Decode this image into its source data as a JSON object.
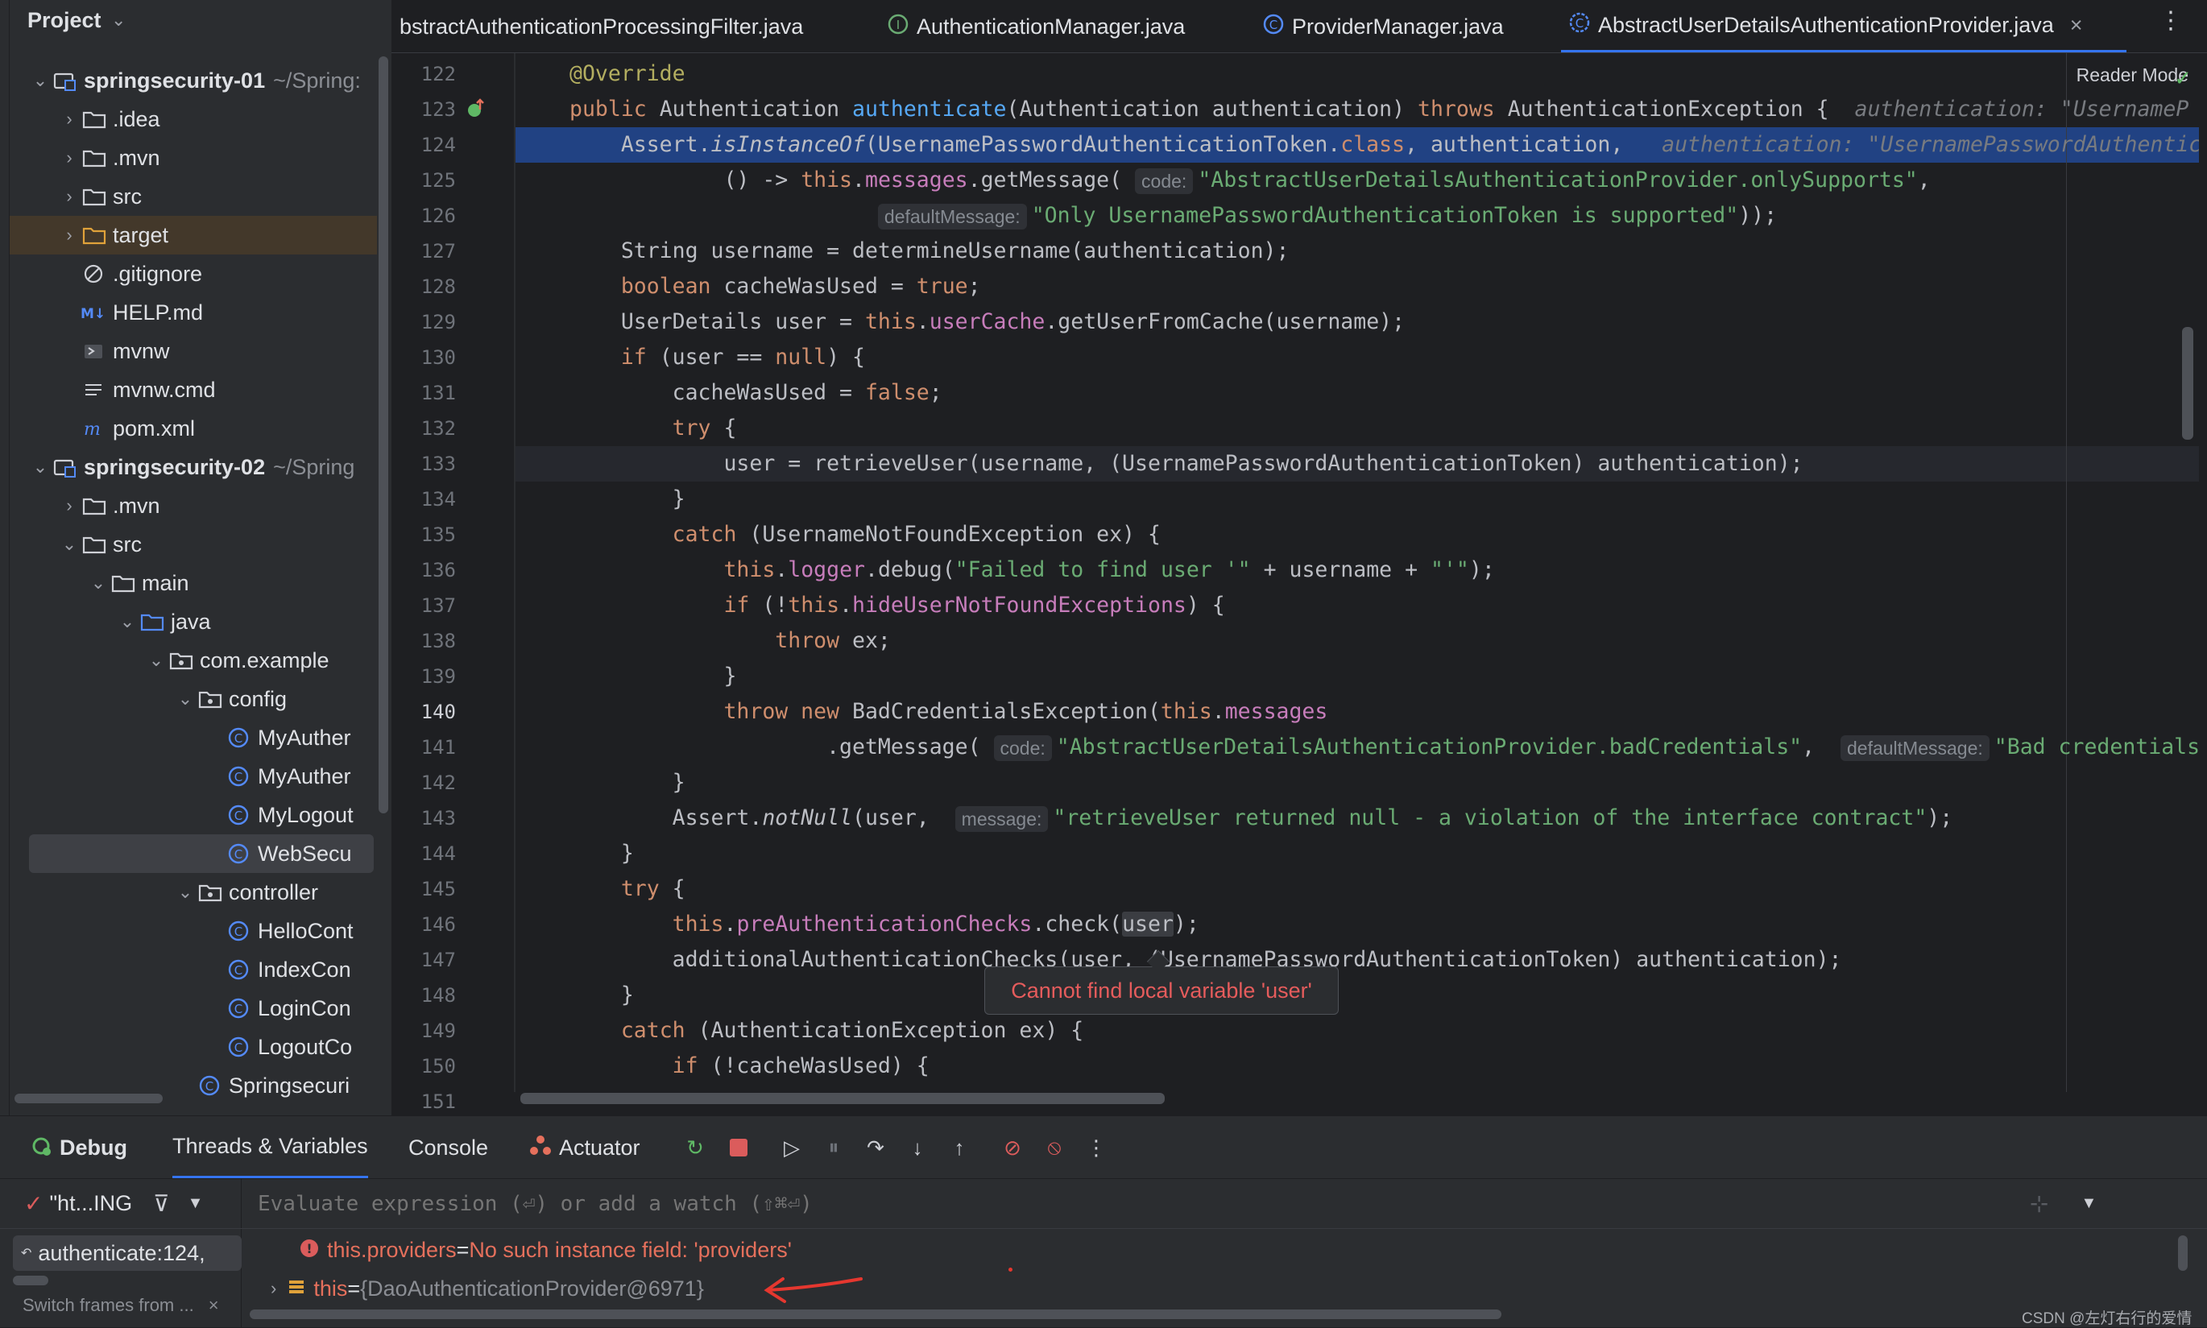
{
  "project": {
    "title": "Project",
    "tree": [
      {
        "label": "springsecurity-01",
        "note": "~/Spring:",
        "type": "module",
        "expanded": true,
        "indent": 0
      },
      {
        "label": ".idea",
        "type": "folder",
        "expanded": false,
        "indent": 1
      },
      {
        "label": ".mvn",
        "type": "folder",
        "expanded": false,
        "indent": 1
      },
      {
        "label": "src",
        "type": "folder",
        "expanded": false,
        "indent": 1
      },
      {
        "label": "target",
        "type": "folder-excluded",
        "expanded": false,
        "indent": 1
      },
      {
        "label": ".gitignore",
        "type": "ignore",
        "indent": 1
      },
      {
        "label": "HELP.md",
        "type": "md",
        "indent": 1
      },
      {
        "label": "mvnw",
        "type": "shell",
        "indent": 1
      },
      {
        "label": "mvnw.cmd",
        "type": "text",
        "indent": 1
      },
      {
        "label": "pom.xml",
        "type": "maven",
        "indent": 1
      },
      {
        "label": "springsecurity-02",
        "note": "~/Spring",
        "type": "module",
        "expanded": true,
        "indent": 0
      },
      {
        "label": ".mvn",
        "type": "folder",
        "expanded": false,
        "indent": 1
      },
      {
        "label": "src",
        "type": "folder",
        "expanded": true,
        "indent": 1
      },
      {
        "label": "main",
        "type": "folder",
        "expanded": true,
        "indent": 2
      },
      {
        "label": "java",
        "type": "folder-src",
        "expanded": true,
        "indent": 3
      },
      {
        "label": "com.example",
        "type": "package",
        "expanded": true,
        "indent": 4
      },
      {
        "label": "config",
        "type": "package",
        "expanded": true,
        "indent": 5
      },
      {
        "label": "MyAuther",
        "type": "class",
        "indent": 6
      },
      {
        "label": "MyAuther",
        "type": "class",
        "indent": 6
      },
      {
        "label": "MyLogout",
        "type": "class",
        "indent": 6
      },
      {
        "label": "WebSecu",
        "type": "class",
        "indent": 6
      },
      {
        "label": "controller",
        "type": "package",
        "expanded": true,
        "indent": 5
      },
      {
        "label": "HelloCont",
        "type": "class",
        "indent": 6
      },
      {
        "label": "IndexCon",
        "type": "class",
        "indent": 6
      },
      {
        "label": "LoginCon",
        "type": "class",
        "indent": 6
      },
      {
        "label": "LogoutCo",
        "type": "class",
        "indent": 6
      },
      {
        "label": "Springsecuri",
        "type": "class",
        "indent": 5
      }
    ]
  },
  "tabs": [
    {
      "label": "bstractAuthenticationProcessingFilter.java",
      "icon": "none"
    },
    {
      "label": "AuthenticationManager.java",
      "icon": "interface"
    },
    {
      "label": "ProviderManager.java",
      "icon": "class"
    },
    {
      "label": "AbstractUserDetailsAuthenticationProvider.java",
      "icon": "abstract-class",
      "active": true
    }
  ],
  "editor": {
    "reader_mode": "Reader Mode",
    "line_numbers": [
      "122",
      "123",
      "124",
      "125",
      "126",
      "127",
      "128",
      "129",
      "130",
      "131",
      "132",
      "133",
      "134",
      "135",
      "136",
      "137",
      "138",
      "139",
      "140",
      "141",
      "142",
      "143",
      "144",
      "145",
      "146",
      "147",
      "148",
      "149",
      "150",
      "151"
    ],
    "highlighted_line": "124",
    "current_line": "140",
    "tooltip": "Cannot find local variable 'user'",
    "inline_hint_123": "authentication: \"UsernameP",
    "inline_hint_124": "authentication: \"UsernamePasswordAuthentic",
    "hint_labels": {
      "code": "code:",
      "defaultMessage": "defaultMessage:",
      "message": "message:"
    }
  },
  "toolwindow": {
    "tabs": [
      {
        "label": "Debug",
        "icon": "debug-icon"
      },
      {
        "label": "Threads & Variables",
        "active": true
      },
      {
        "label": "Console"
      },
      {
        "label": "Actuator",
        "icon": "actuator-icon"
      }
    ],
    "thread": "\"ht...ING",
    "frame": "authenticate:124,",
    "switch_frames": "Switch frames from ...",
    "eval_placeholder": "Evaluate expression (⏎) or add a watch (⇧⌘⏎)",
    "variables": [
      {
        "name": "this.providers",
        "sep": " = ",
        "value": "No such instance field: 'providers'",
        "kind": "error"
      },
      {
        "name": "this",
        "sep": " = ",
        "value": "{DaoAuthenticationProvider@6971}",
        "kind": "object"
      }
    ]
  },
  "watermark": "CSDN @左灯右行的爱情"
}
